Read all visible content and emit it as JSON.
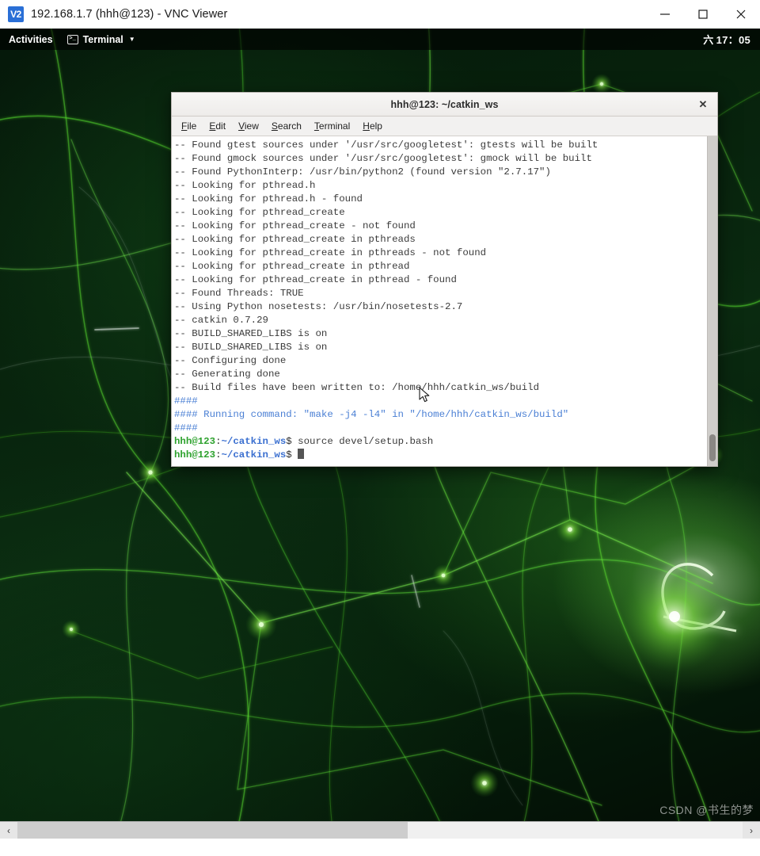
{
  "vnc_window": {
    "title": "192.168.1.7 (hhh@123) - VNC Viewer",
    "logo_label": "V2",
    "controls": {
      "minimize": "minimize-icon",
      "maximize": "maximize-icon",
      "close": "close-icon"
    }
  },
  "gnome_topbar": {
    "activities_label": "Activities",
    "app_menu_label": "Terminal",
    "app_icon_glyph": ">_",
    "caret_glyph": "▼",
    "clock": {
      "weekday": "六",
      "time": "17：05"
    }
  },
  "terminal": {
    "title": "hhh@123: ~/catkin_ws",
    "close_glyph": "✕",
    "menu": [
      {
        "mnemonic": "F",
        "rest": "ile"
      },
      {
        "mnemonic": "E",
        "rest": "dit"
      },
      {
        "mnemonic": "V",
        "rest": "iew"
      },
      {
        "mnemonic": "S",
        "rest": "earch"
      },
      {
        "mnemonic": "T",
        "rest": "erminal"
      },
      {
        "mnemonic": "H",
        "rest": "elp"
      }
    ],
    "lines": [
      {
        "type": "plain",
        "text": "-- Found gtest sources under '/usr/src/googletest': gtests will be built"
      },
      {
        "type": "plain",
        "text": "-- Found gmock sources under '/usr/src/googletest': gmock will be built"
      },
      {
        "type": "plain",
        "text": "-- Found PythonInterp: /usr/bin/python2 (found version \"2.7.17\")"
      },
      {
        "type": "plain",
        "text": "-- Looking for pthread.h"
      },
      {
        "type": "plain",
        "text": "-- Looking for pthread.h - found"
      },
      {
        "type": "plain",
        "text": "-- Looking for pthread_create"
      },
      {
        "type": "plain",
        "text": "-- Looking for pthread_create - not found"
      },
      {
        "type": "plain",
        "text": "-- Looking for pthread_create in pthreads"
      },
      {
        "type": "plain",
        "text": "-- Looking for pthread_create in pthreads - not found"
      },
      {
        "type": "plain",
        "text": "-- Looking for pthread_create in pthread"
      },
      {
        "type": "plain",
        "text": "-- Looking for pthread_create in pthread - found"
      },
      {
        "type": "plain",
        "text": "-- Found Threads: TRUE"
      },
      {
        "type": "plain",
        "text": "-- Using Python nosetests: /usr/bin/nosetests-2.7"
      },
      {
        "type": "plain",
        "text": "-- catkin 0.7.29"
      },
      {
        "type": "plain",
        "text": "-- BUILD_SHARED_LIBS is on"
      },
      {
        "type": "plain",
        "text": "-- BUILD_SHARED_LIBS is on"
      },
      {
        "type": "plain",
        "text": "-- Configuring done"
      },
      {
        "type": "plain",
        "text": "-- Generating done"
      },
      {
        "type": "plain",
        "text": "-- Build files have been written to: /home/hhh/catkin_ws/build"
      },
      {
        "type": "hash",
        "text": "####"
      },
      {
        "type": "hash",
        "text": "#### Running command: \"make -j4 -l4\" in \"/home/hhh/catkin_ws/build\""
      },
      {
        "type": "hash",
        "text": "####"
      },
      {
        "type": "prompt",
        "user": "hhh@123",
        "sep": ":",
        "path": "~/catkin_ws",
        "dollar": "$",
        "command": " source devel/setup.bash"
      },
      {
        "type": "prompt-cursor",
        "user": "hhh@123",
        "sep": ":",
        "path": "~/catkin_ws",
        "dollar": "$",
        "command": " "
      }
    ]
  },
  "vnc_scrollbar": {
    "left_arrow": "‹",
    "right_arrow": "›"
  },
  "watermark": {
    "text": "CSDN @书生的梦"
  },
  "colors": {
    "prompt_user": "#2fa22f",
    "prompt_path": "#3a6fd0",
    "hash_blue": "#4a7fd4",
    "terminal_text": "#3b3b3b",
    "vnc_logo": "#2a6fd6"
  }
}
